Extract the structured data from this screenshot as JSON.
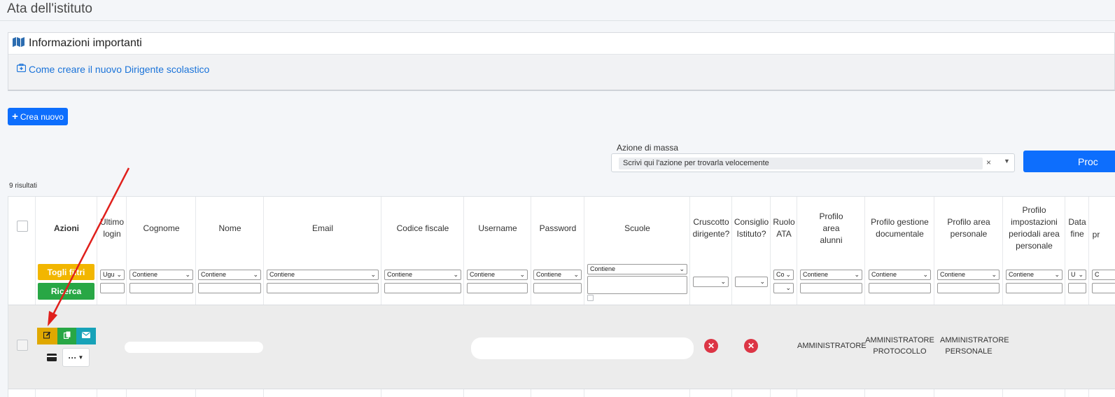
{
  "page": {
    "title": "Ata dell'istituto"
  },
  "info": {
    "title": "Informazioni importanti",
    "link": "Come creare il nuovo Dirigente scolastico",
    "icon": "map-icon",
    "link_icon": "medkit-icon"
  },
  "toolbar": {
    "create_label": "Crea nuovo"
  },
  "mass_action": {
    "label": "Azione di massa",
    "placeholder": "Scrivi qui l'azione per trovarla velocemente",
    "clear": "×",
    "proceed_label": "Proc"
  },
  "results": {
    "count_label": "9 risultati"
  },
  "table": {
    "headers": {
      "azioni": "Azioni",
      "ultimo_login": "Ultimo login",
      "cognome": "Cognome",
      "nome": "Nome",
      "email": "Email",
      "codice_fiscale": "Codice fiscale",
      "username": "Username",
      "password": "Password",
      "scuole": "Scuole",
      "cruscotto": "Cruscotto dirigente?",
      "consiglio": "Consiglio Istituto?",
      "ruolo": "Ruolo ATA",
      "profilo_alunni": "Profilo area alunni",
      "profilo_documentale": "Profilo gestione documentale",
      "profilo_personale": "Profilo area personale",
      "profilo_impostazioni": "Profilo impostazioni periodali area personale",
      "data_fine": "Data fine",
      "pr": "pr"
    },
    "filters": {
      "contains": "Contiene",
      "ultimo_login": "Ugu",
      "ruolo": "Co",
      "data_fine": "U",
      "last": "C",
      "togli_filtri": "Togli filtri",
      "ricerca": "Ricerca"
    },
    "row": {
      "ruolo_ata": "",
      "profilo_alunni": "AMMINISTRATORE",
      "profilo_documentale": "AMMINISTRATORE PROTOCOLLO",
      "profilo_personale": "AMMINISTRATORE PERSONALE",
      "more_label": "···"
    }
  },
  "colors": {
    "primary": "#0d6efd",
    "warning": "#f2b600",
    "success": "#28a745",
    "info": "#17a2b8",
    "danger": "#dc3545",
    "arrow": "#e0201c"
  }
}
